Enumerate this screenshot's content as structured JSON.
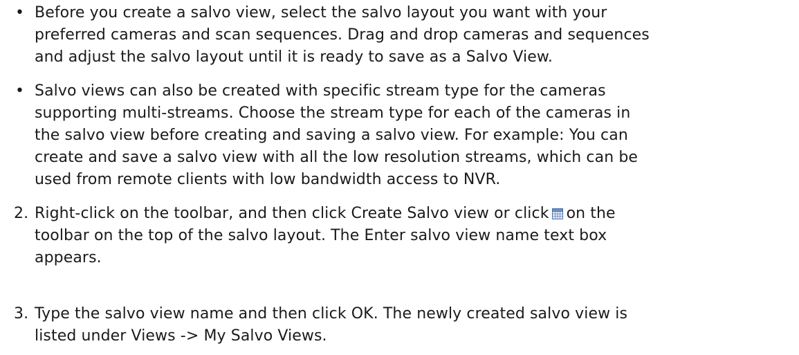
{
  "bullets": [
    {
      "marker": "•",
      "lines": [
        "Before you create a salvo view, select the salvo layout you want with your",
        "preferred cameras and scan sequences. Drag and drop cameras and sequences",
        "and adjust the salvo layout until it is ready to save as a Salvo View."
      ]
    },
    {
      "marker": "•",
      "lines": [
        "Salvo views can also be created with specific stream type for the cameras",
        "supporting multi-streams. Choose the stream type for each of the cameras in",
        "the salvo view before creating and saving a salvo view. For example: You can",
        "create and save a salvo view with all the low resolution streams, which can be",
        "used from remote clients with low bandwidth access to NVR."
      ]
    }
  ],
  "steps": [
    {
      "number": "2.",
      "line1_before_icon": "Right-click on the toolbar, and then click Create Salvo view or click",
      "icon": "salvo-grid-icon",
      "line1_after_icon": "on the",
      "lines": [
        "toolbar on the top of the salvo layout. The Enter salvo view name text box",
        "appears."
      ]
    },
    {
      "number": "3.",
      "lines": [
        "Type the salvo view name and then click OK. The newly created salvo view is",
        "listed under Views -> My Salvo Views."
      ]
    }
  ]
}
